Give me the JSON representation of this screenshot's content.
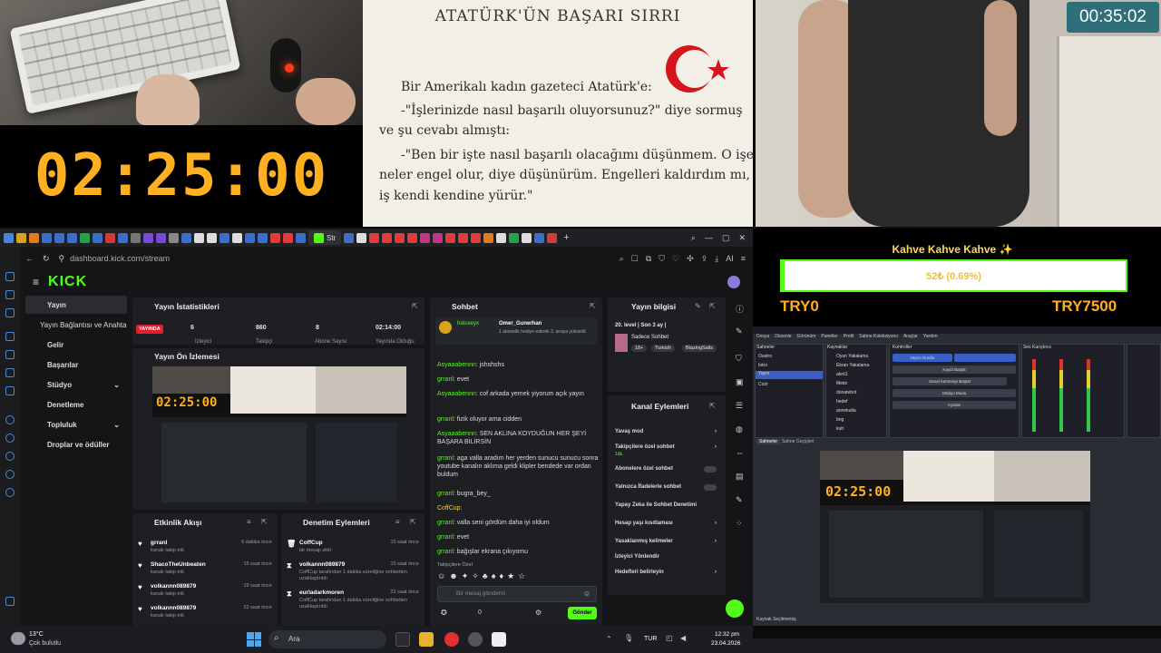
{
  "webcam": {
    "big_timer": "02:25:00",
    "corner_timer": "00:35:02"
  },
  "book": {
    "title": "ATATÜRK'ÜN BAŞARI SIRRI",
    "lines": [
      "Bir Amerikalı kadın gazeteci Atatürk'e:",
      "-\"İşlerinizde nasıl başarılı oluyorsunuz?\" diye sormuş",
      "ve şu cevabı almıştı:",
      "-\"Ben bir işte nasıl başarılı olacağımı düşünmem. O işe",
      "neler engel olur, diye düşünürüm. Engelleri kaldırdım mı,",
      "iş kendi kendine yürür.\""
    ]
  },
  "browser": {
    "url": "dashboard.kick.com/stream",
    "logo": "KICK",
    "active_tab_label": "Str",
    "ai_label": "AI"
  },
  "sidebar": {
    "items": [
      {
        "label": "Yayın",
        "active": true
      },
      {
        "label": "Yayın Bağlantısı ve Anahtarı"
      },
      {
        "label": "Gelir"
      },
      {
        "label": "Başarılar"
      },
      {
        "label": "Stüdyo"
      },
      {
        "label": "Denetleme"
      },
      {
        "label": "Topluluk"
      },
      {
        "label": "Droplar ve ödüller"
      }
    ]
  },
  "stats": {
    "title": "Yayın İstatistikleri",
    "badge": "YAYINDA",
    "values": [
      {
        "value": "6",
        "label": "İzleyici"
      },
      {
        "value": "860",
        "label": "Takipçi"
      },
      {
        "value": "8",
        "label": "Abone Sayısı"
      },
      {
        "value": "02:14:00",
        "label": "Yayında Olduğu"
      }
    ]
  },
  "preview": {
    "title": "Yayın Ön İzlemesi",
    "timer": "02:25:00"
  },
  "chat": {
    "title": "Sohbet",
    "pinned_user": "hatceeyx",
    "pinned_target": "Omer_Gunerhan",
    "pinned_note": "1 abonelik hediye ederek 3. sıraya yükseldi",
    "messages": [
      {
        "user": "Asyaaabennn",
        "text": ": jshshshs"
      },
      {
        "user": "grranl",
        "text": ": evet"
      },
      {
        "user": "Asyaaabennn",
        "text": ": cof arkada yemek yiyorum açık yayın"
      },
      {
        "user": "grranl",
        "text": ": fizik oluyor ama cidden"
      },
      {
        "user": "Asyaaabennn",
        "text": ": SEN AKLINA KOYDUĞUN HER ŞEYİ BAŞARA BİLİRSİN"
      },
      {
        "user": "grranl",
        "text": ": aga valla aradım her yerden sunucu sunucu sonra youtube kanalın aklıma geldi klipler bendede var ordan buldum"
      },
      {
        "user": "grranl",
        "text": ": bugra_bey_"
      },
      {
        "user": "CoffCup",
        "text": ":"
      },
      {
        "user": "grranl",
        "text": ": valla seni gördüm daha iyi oldum"
      },
      {
        "user": "grranl",
        "text": ": evet"
      },
      {
        "user": "grranl",
        "text": ": bağışlar ekrana çıkıyomu"
      }
    ],
    "followers_label": "Takipçilere Özel",
    "input_placeholder": "Bir mesaj gönderin",
    "count": "0",
    "send_label": "Gönder"
  },
  "stream_info": {
    "title": "Yayın bilgisi",
    "stream_name": "20. level | Son 3 ay |",
    "category": "Sadece Sohbet",
    "tags": [
      "18+",
      "Turkish",
      "BlazingSails"
    ]
  },
  "channel_actions": {
    "title": "Kanal Eylemleri",
    "items": [
      "Yavaş mod",
      "Takipçilere özel sohbet",
      "Abonelere özel sohbet",
      "Yalnızca İfadelerle sohbet",
      "Yapay Zeka ile Sohbet Denetimi",
      "Hesap yaşı kısıtlaması",
      "Yasaklanmış kelimeler",
      "İzleyici Yönlendir",
      "Hedefleri belirleyin"
    ],
    "follower_sub": "1dk."
  },
  "event_feed": {
    "title": "Etkinlik Akışı",
    "items": [
      {
        "user": "grranl",
        "desc": "kanalı takip etti",
        "time": "9 dakika önce"
      },
      {
        "user": "ShacoTheUnbeaten",
        "desc": "kanalı takip etti",
        "time": "15 saat önce"
      },
      {
        "user": "volkannn089879",
        "desc": "kanalı takip etti",
        "time": "19 saat önce"
      },
      {
        "user": "volkannn089879",
        "desc": "kanalı takip etti",
        "time": "22 saat önce"
      }
    ]
  },
  "mod_actions": {
    "title": "Denetim Eylemleri",
    "items": [
      {
        "user": "CoffCup",
        "desc": "bir mesajı sildi",
        "time": "15 saat önce"
      },
      {
        "user": "volkannn089879",
        "desc": "CoffCup tarafından 1 dakika süreliğine sohbetten uzaklaştırıldı",
        "time": "15 saat önce"
      },
      {
        "user": "eurladarkmoren",
        "desc": "CoffCup tarafından 1 dakika süreliğine sohbetten uzaklaştırıldı",
        "time": "22 saat önce"
      }
    ]
  },
  "goal": {
    "title": "Kahve Kahve Kahve ✨",
    "amount": "52₺ (0.69%)",
    "progress": 0.0069,
    "left": "TRY0",
    "right": "TRY7500"
  },
  "obs": {
    "menus": [
      "Dosya",
      "Düzenle",
      "Görünüm",
      "Paneller",
      "Profil",
      "Sahne Koleksiyonu",
      "Araçlar",
      "Yardım"
    ],
    "scenes_title": "Sahneler",
    "scenes": [
      "Oustro",
      "Intro",
      "Yayın",
      "Cozt"
    ],
    "sources_title": "Kaynaklar",
    "sources": [
      "Oyun Yakalama",
      "Ekran Yakalama",
      "alert1",
      "Metin",
      "donatebot",
      "hedef",
      "annekutla",
      "bng",
      "kutr"
    ],
    "controls_title": "Kontroller",
    "controls": [
      "Yayını Durdur",
      "Kaydı Başlat",
      "Sanal Kamerayı Başlat",
      "Stüdyo Modu",
      "Ayarlar"
    ],
    "mixer_title": "Ses Karıştırıcı",
    "tabs": [
      "Sahneler",
      "Sahne Geçişleri"
    ],
    "status_left": "Kaynak Seçilmemiş",
    "timer": "02:25:00"
  },
  "taskbar": {
    "weather_temp": "13°C",
    "weather_desc": "Çok bulutlu",
    "search": "Ara",
    "lang": "TUR",
    "time": "12:32 pm",
    "date": "23.04.2026"
  }
}
